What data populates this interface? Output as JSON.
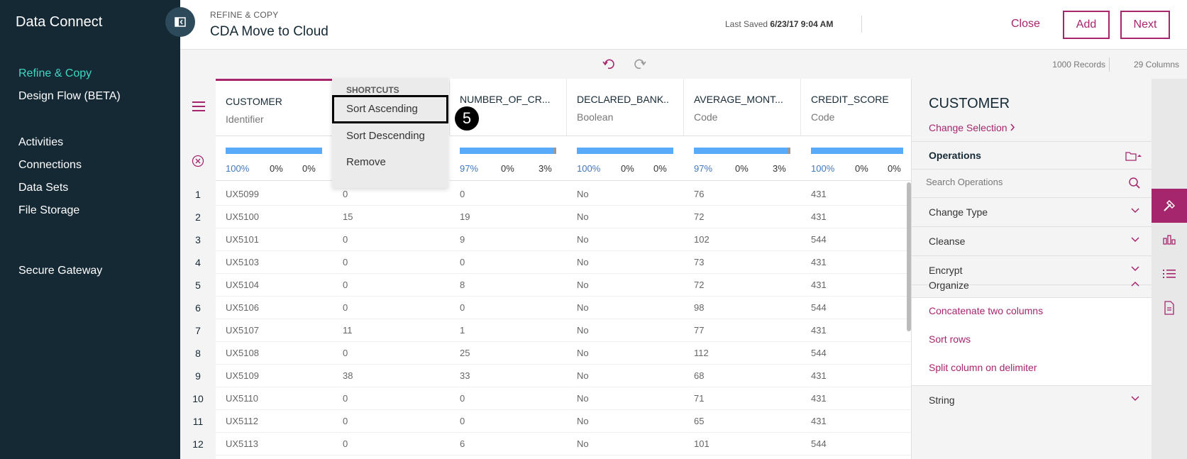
{
  "app": {
    "title": "Data Connect"
  },
  "sidebar": {
    "primary": [
      {
        "label": "Refine & Copy",
        "active": true
      },
      {
        "label": "Design Flow (BETA)",
        "active": false
      }
    ],
    "secondary": [
      {
        "label": "Activities"
      },
      {
        "label": "Connections"
      },
      {
        "label": "Data Sets"
      },
      {
        "label": "File Storage"
      }
    ],
    "tertiary": [
      {
        "label": "Secure Gateway"
      }
    ]
  },
  "header": {
    "breadcrumb": "REFINE & COPY",
    "title": "CDA Move to Cloud",
    "last_saved_label": "Last Saved",
    "last_saved_value": "6/23/17 9:04 AM",
    "close_label": "Close",
    "add_label": "Add",
    "next_label": "Next"
  },
  "toolbar": {
    "records": "1000 Records",
    "columns": "29 Columns"
  },
  "grid": {
    "columns": [
      {
        "name": "CUSTOMER",
        "type": "Identifier",
        "valid": "100%",
        "invalid": "0%",
        "missing": "0%",
        "missing_frac": 0
      },
      {
        "name": "",
        "type": "",
        "valid": "",
        "invalid": "",
        "missing": "",
        "missing_frac": 0
      },
      {
        "name": "NUMBER_OF_CR...",
        "type": "e",
        "valid": "97%",
        "invalid": "0%",
        "missing": "3%",
        "missing_frac": 0.03
      },
      {
        "name": "DECLARED_BANK..",
        "type": "Boolean",
        "valid": "100%",
        "invalid": "0%",
        "missing": "0%",
        "missing_frac": 0
      },
      {
        "name": "AVERAGE_MONT...",
        "type": "Code",
        "valid": "97%",
        "invalid": "0%",
        "missing": "3%",
        "missing_frac": 0.03
      },
      {
        "name": "CREDIT_SCORE",
        "type": "Code",
        "valid": "100%",
        "invalid": "0%",
        "missing": "0%",
        "missing_frac": 0
      }
    ],
    "rows": [
      [
        "1",
        "UX5099",
        "0",
        "0",
        "No",
        "76",
        "431"
      ],
      [
        "2",
        "UX5100",
        "15",
        "19",
        "No",
        "72",
        "431"
      ],
      [
        "3",
        "UX5101",
        "0",
        "9",
        "No",
        "102",
        "544"
      ],
      [
        "4",
        "UX5103",
        "0",
        "0",
        "No",
        "73",
        "431"
      ],
      [
        "5",
        "UX5104",
        "0",
        "8",
        "No",
        "72",
        "431"
      ],
      [
        "6",
        "UX5106",
        "0",
        "0",
        "No",
        "98",
        "544"
      ],
      [
        "7",
        "UX5107",
        "11",
        "1",
        "No",
        "77",
        "431"
      ],
      [
        "8",
        "UX5108",
        "0",
        "25",
        "No",
        "112",
        "544"
      ],
      [
        "9",
        "UX5109",
        "38",
        "33",
        "No",
        "68",
        "431"
      ],
      [
        "10",
        "UX5110",
        "0",
        "0",
        "No",
        "71",
        "431"
      ],
      [
        "11",
        "UX5112",
        "0",
        "0",
        "No",
        "65",
        "431"
      ],
      [
        "12",
        "UX5113",
        "0",
        "6",
        "No",
        "101",
        "544"
      ]
    ]
  },
  "shortcuts": {
    "title": "SHORTCUTS",
    "items": [
      "Sort Ascending",
      "Sort Descending",
      "Remove"
    ],
    "step_badge": "5"
  },
  "panel": {
    "title": "CUSTOMER",
    "change_selection": "Change Selection",
    "operations_label": "Operations",
    "search_placeholder": "Search Operations",
    "sections": [
      "Change Type",
      "Cleanse",
      "Encrypt",
      "Organize"
    ],
    "organize_items": [
      "Concatenate two columns",
      "Sort rows",
      "Split column on delimiter"
    ],
    "last_section": "String"
  },
  "colors": {
    "sidebar_bg": "#152935",
    "accent": "#a6266e",
    "active_nav": "#41d6c3",
    "quality_bar": "#5aaafa"
  }
}
